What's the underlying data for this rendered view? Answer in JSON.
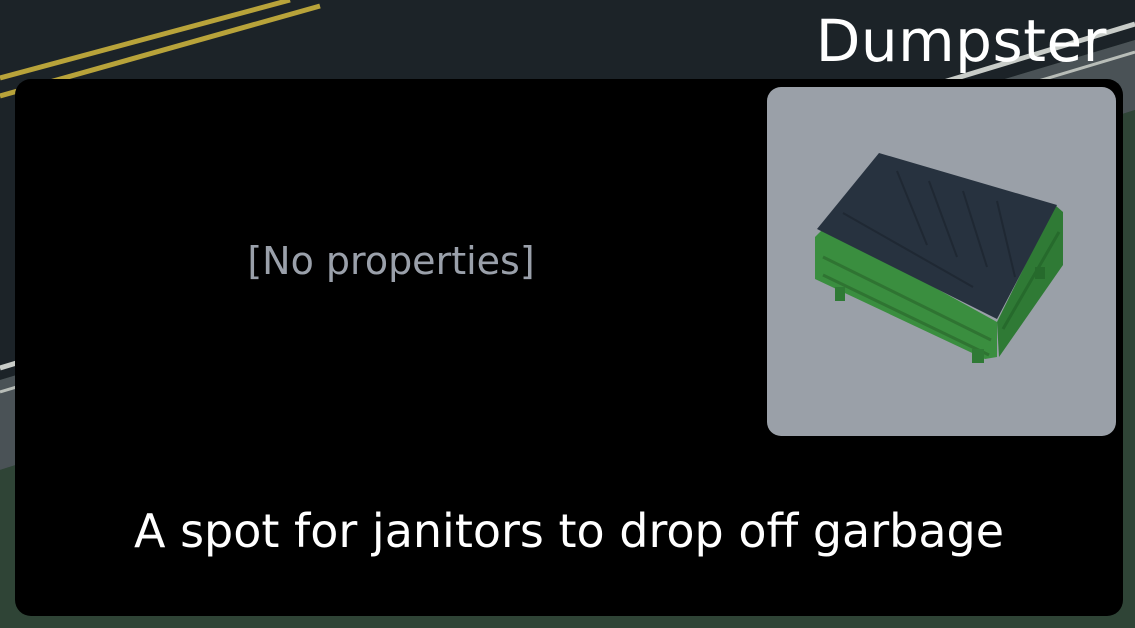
{
  "item": {
    "title": "Dumpster",
    "properties_text": "[No properties]",
    "description": "A spot for janitors to drop off garbage",
    "preview_icon": "dumpster-model"
  },
  "colors": {
    "panel_background": "#000000",
    "title_text": "#ffffff",
    "properties_text": "#9aa0aa",
    "description_text": "#ffffff",
    "preview_background": "#9aa0a8",
    "dumpster_body": "#3f9a44",
    "dumpster_lid": "#27323f",
    "road_asphalt": "#1c2328",
    "road_center_line": "#b8a33a",
    "grass": "#2f4436"
  }
}
